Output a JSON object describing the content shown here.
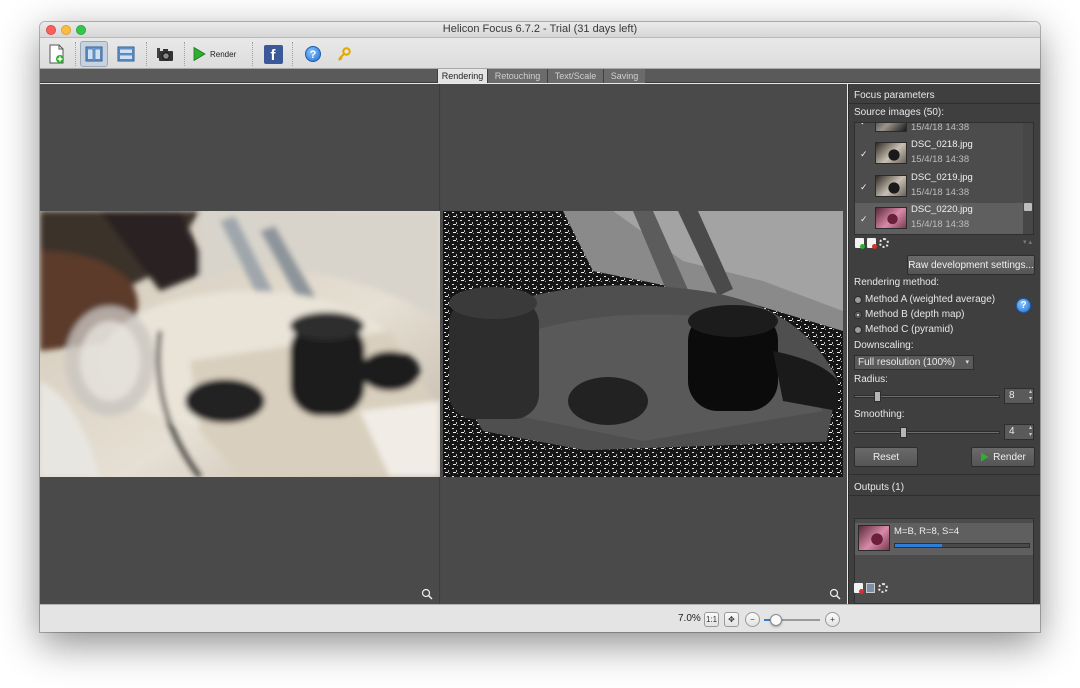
{
  "window": {
    "title": "Helicon Focus 6.7.2 - Trial (31 days left)"
  },
  "toolbar": {
    "items": [
      {
        "icon": "add-files-icon"
      },
      {
        "icon": "two-panes-vertical-icon"
      },
      {
        "icon": "two-panes-horizontal-icon"
      },
      {
        "icon": "camera-icon"
      },
      {
        "icon": "render-play-icon",
        "label": "Render"
      },
      {
        "icon": "facebook-icon",
        "label": "f"
      },
      {
        "icon": "help-icon",
        "label": "?"
      },
      {
        "icon": "key-icon"
      }
    ]
  },
  "tabs": [
    {
      "label": "Rendering",
      "active": true
    },
    {
      "label": "Retouching",
      "active": false
    },
    {
      "label": "Text/Scale",
      "active": false
    },
    {
      "label": "Saving",
      "active": false
    }
  ],
  "panel": {
    "title": "Focus parameters",
    "source_images_label": "Source images (50):",
    "source_images": [
      {
        "name": "",
        "date": "15/4/18 14:38",
        "checked": true,
        "selected": false
      },
      {
        "name": "DSC_0218.jpg",
        "date": "15/4/18 14:38",
        "checked": true,
        "selected": false
      },
      {
        "name": "DSC_0219.jpg",
        "date": "15/4/18 14:38",
        "checked": true,
        "selected": false
      },
      {
        "name": "DSC_0220.jpg",
        "date": "15/4/18 14:38",
        "checked": true,
        "selected": true
      }
    ],
    "check_mark": "✓",
    "raw_button": "Raw development settings...",
    "rendering_method_label": "Rendering method:",
    "methods": [
      {
        "label": "Method A (weighted average)",
        "selected": false
      },
      {
        "label": "Method B (depth map)",
        "selected": true
      },
      {
        "label": "Method C (pyramid)",
        "selected": false
      }
    ],
    "help_label": "?",
    "downscaling_label": "Downscaling:",
    "downscaling_value": "Full resolution (100%)",
    "radius_label": "Radius:",
    "radius_value": "8",
    "smoothing_label": "Smoothing:",
    "smoothing_value": "4",
    "reset_button": "Reset",
    "render_button": "Render",
    "outputs_label": "Outputs (1)",
    "output": {
      "label": "M=B, R=8, S=4",
      "progress": 0.35
    }
  },
  "statusbar": {
    "zoom": "7.0%",
    "zoom_slider_level": 0.1
  },
  "colors": {
    "accent_blue": "#2f7fd9",
    "render_green": "#2fae2f",
    "panel_bg": "#3f3f3f",
    "view_bg": "#4a4a4a"
  }
}
